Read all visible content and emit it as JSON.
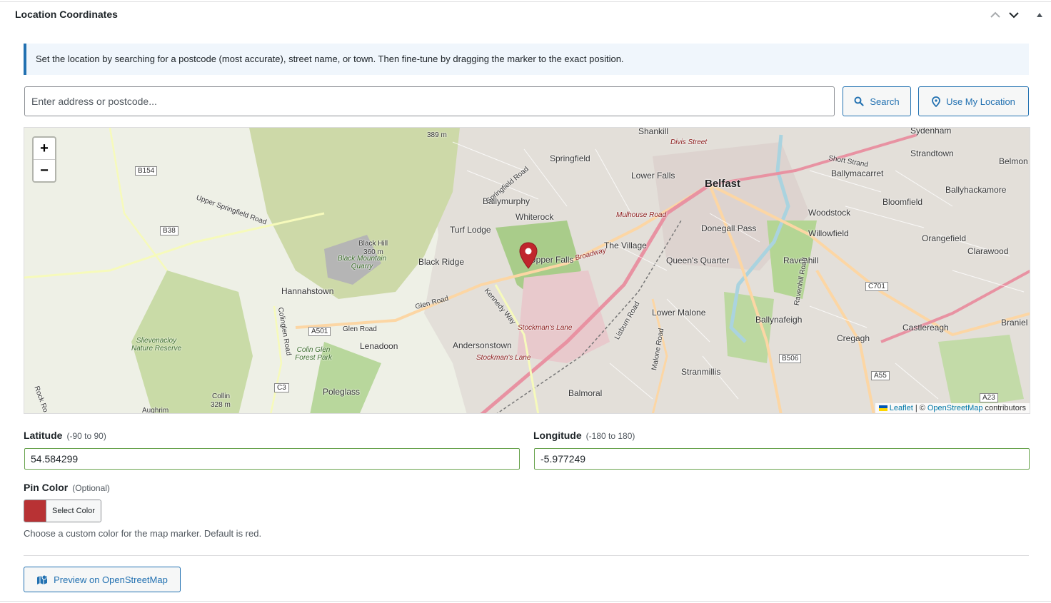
{
  "header": {
    "title": "Location Coordinates"
  },
  "notice": {
    "text": "Set the location by searching for a postcode (most accurate), street name, or town. Then fine-tune by dragging the marker to the exact position."
  },
  "search": {
    "placeholder": "Enter address or postcode...",
    "value": "",
    "search_label": "Search",
    "location_label": "Use My Location"
  },
  "map": {
    "zoom_in": "+",
    "zoom_out": "−",
    "attribution_leaflet": "Leaflet",
    "attribution_sep": "| ©",
    "attribution_osm": "OpenStreetMap",
    "attribution_suffix": "contributors",
    "places": {
      "belfast": "Belfast",
      "shankill": "Shankill",
      "springfield": "Springfield",
      "lower_falls": "Lower Falls",
      "ballymurphy": "Ballymurphy",
      "whiterock": "Whiterock",
      "turf_lodge": "Turf Lodge",
      "black_ridge": "Black Ridge",
      "upper_falls": "Upper Falls",
      "the_village": "The Village",
      "queens_quarter": "Queen's Quarter",
      "donegall_pass": "Donegall Pass",
      "woodstock": "Woodstock",
      "willowfield": "Willowfield",
      "ravenhill": "Ravenhill",
      "ballymacarret": "Ballymacarret",
      "strandtown": "Strandtown",
      "sydenham": "Sydenham",
      "belmont": "Belmon",
      "ballyhackamore": "Ballyhackamore",
      "bloomfield": "Bloomfield",
      "orangefield": "Orangefield",
      "clarawood": "Clarawood",
      "hannahstown": "Hannahstown",
      "lenadoon": "Lenadoon",
      "andersonstown": "Andersonstown",
      "lower_malone": "Lower Malone",
      "ballynafeigh": "Ballynafeigh",
      "cregagh": "Cregagh",
      "castlereagh": "Castlereagh",
      "braniel": "Braniel",
      "stranmillis": "Stranmillis",
      "balmoral": "Balmoral",
      "poleglass": "Poleglass",
      "collin": "Collin",
      "collin_height": "328 m",
      "black_hill": "Black Hill",
      "black_hill_height": "360 m",
      "quarry": "Black Mountain Quarry",
      "slievenacloy": "Slievenacloy Nature Reserve",
      "colin_glen": "Colin Glen Forest Park",
      "peak_height": "389 m",
      "aughrim": "Aughrim"
    },
    "roads": {
      "divis": "Divis Street",
      "mulhouse": "Mulhouse Road",
      "broadway": "Broadway",
      "stockmans1": "Stockman's Lane",
      "stockmans2": "Stockman's Lane",
      "short_strand": "Short Strand",
      "glen_road": "Glen Road",
      "upper_springfield": "Upper Springfield Road",
      "springfield_road": "Springfield Road",
      "kennedy_way": "Kennedy Way",
      "lisburn_road": "Lisburn Road",
      "malone_road": "Malone Road",
      "ravenhill_road": "Ravenhill Road",
      "glen_road2": "Glen Road",
      "colinglen_road": "Colinglen Road",
      "rock_road": "Rock Ro"
    },
    "shields": {
      "b154": "B154",
      "b38": "B38",
      "a501": "A501",
      "c3": "C3",
      "c701": "C701",
      "b506": "B506",
      "a55": "A55",
      "a23": "A23"
    }
  },
  "latitude": {
    "label": "Latitude",
    "hint": "(-90 to 90)",
    "value": "54.584299"
  },
  "longitude": {
    "label": "Longitude",
    "hint": "(-180 to 180)",
    "value": "-5.977249"
  },
  "pin_color": {
    "label": "Pin Color",
    "hint": "(Optional)",
    "button_label": "Select Color",
    "color": "#b83234",
    "description": "Choose a custom color for the map marker. Default is red."
  },
  "preview": {
    "label": "Preview on OpenStreetMap"
  },
  "colors": {
    "accent": "#2271b1",
    "valid_border": "#68a34d",
    "marker": "#c0262d"
  },
  "icons": {
    "collapse": "chevron-up-icon",
    "expand": "chevron-down-icon",
    "toggle": "triangle-up-icon",
    "search": "search-icon",
    "location": "map-pin-icon",
    "preview": "map-icon"
  }
}
